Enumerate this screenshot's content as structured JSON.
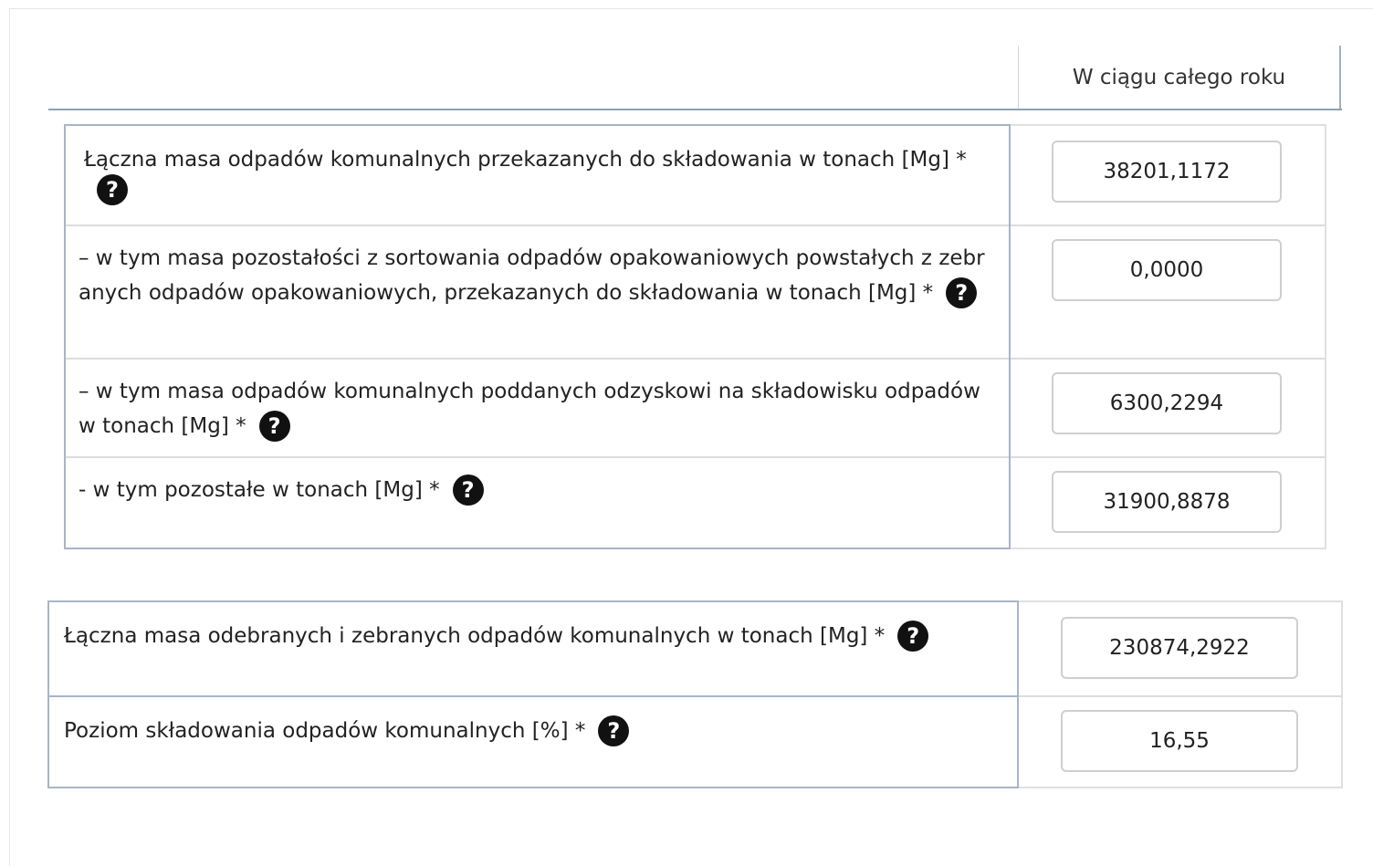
{
  "column_header": "W ciągu całego roku",
  "group1": {
    "rows": [
      {
        "label": "Łączna masa odpadów komunalnych przekazanych do składowania w tonach [Mg] *",
        "value": "38201,1172"
      },
      {
        "label": "– w tym masa pozostałości z sortowania odpadów opakowaniowych powstałych z zebranych odpadów opakowaniowych, przekazanych do składowania w tonach [Mg] *",
        "value": "0,0000"
      },
      {
        "label": "– w tym masa odpadów komunalnych poddanych odzyskowi na składowisku odpadów w tonach [Mg] *",
        "value": "6300,2294"
      },
      {
        "label": "- w tym pozostałe w tonach [Mg] *",
        "value": "31900,8878"
      }
    ]
  },
  "group2": {
    "rows": [
      {
        "label": "Łączna masa odebranych i zebranych odpadów komunalnych w tonach [Mg] *",
        "value": "230874,2922"
      },
      {
        "label": "Poziom składowania odpadów komunalnych [%] *",
        "value": "16,55"
      }
    ]
  },
  "help_glyph": "?",
  "icons": {
    "help": "question-circle-icon"
  }
}
